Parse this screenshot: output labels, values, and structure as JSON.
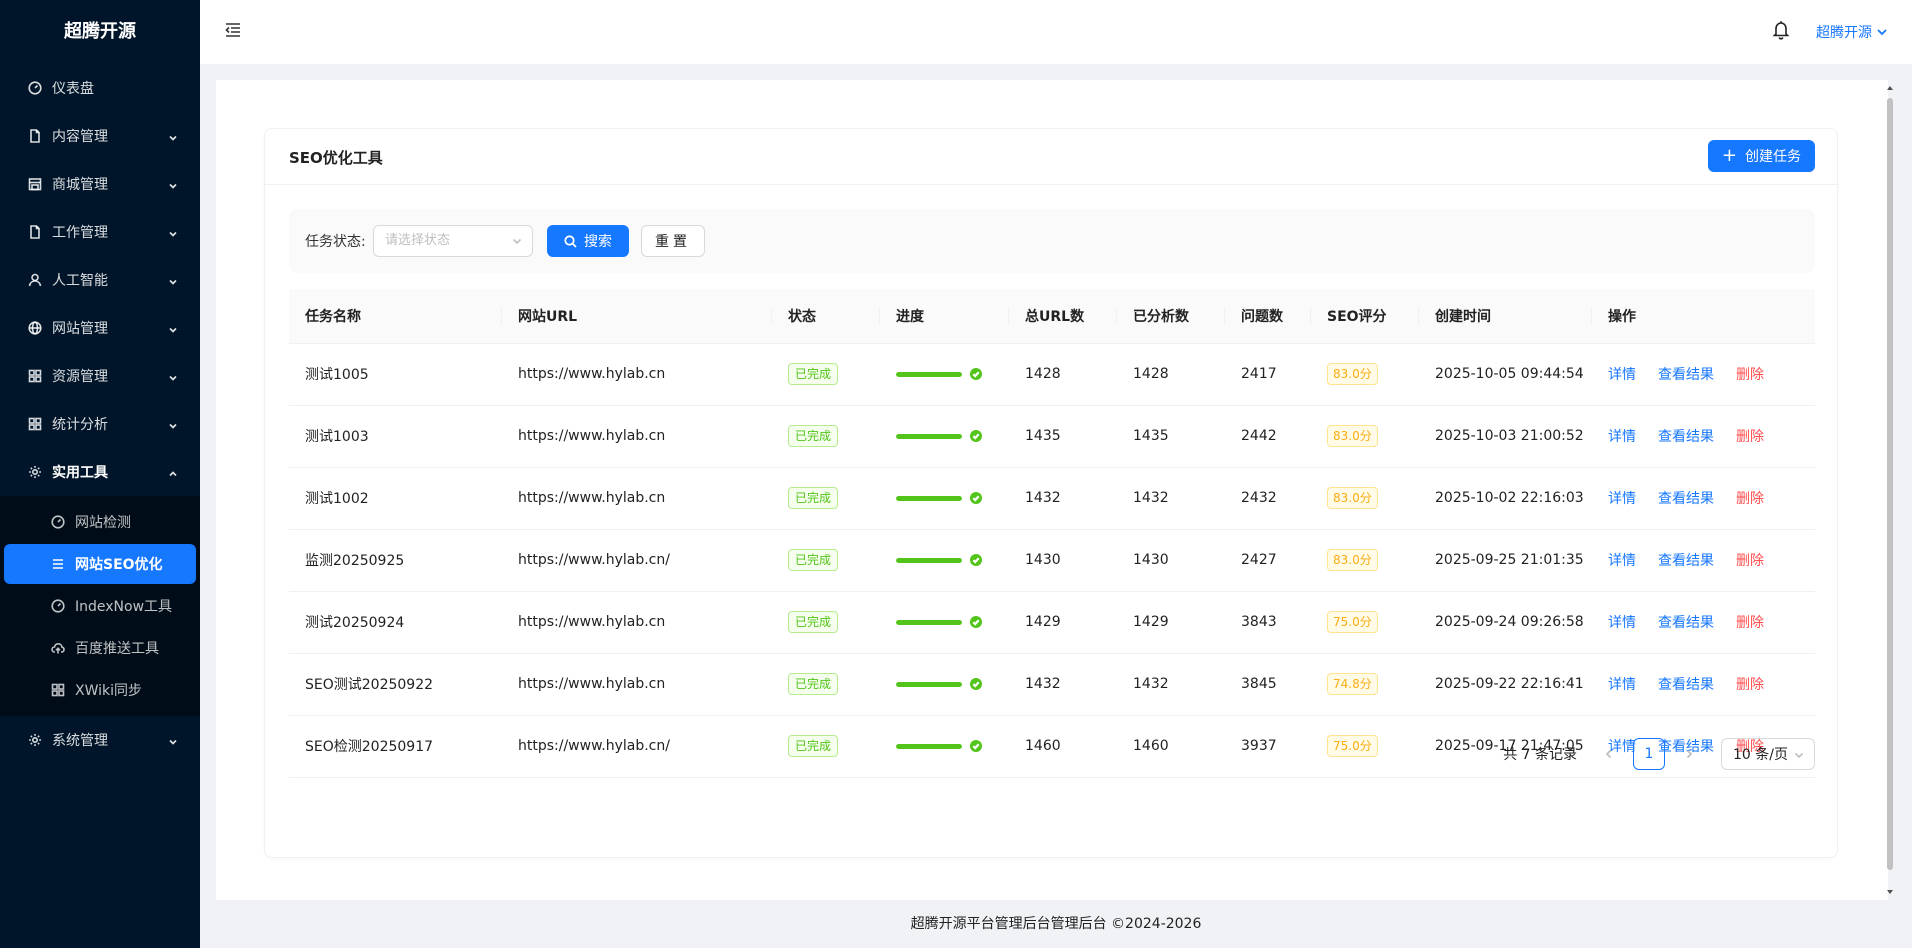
{
  "app": {
    "brand": "超腾开源"
  },
  "sidebar": {
    "items": [
      {
        "label": "仪表盘",
        "icon": "dashboard-icon"
      },
      {
        "label": "内容管理",
        "icon": "file-icon"
      },
      {
        "label": "商城管理",
        "icon": "shop-icon"
      },
      {
        "label": "工作管理",
        "icon": "file-icon"
      },
      {
        "label": "人工智能",
        "icon": "user-icon"
      },
      {
        "label": "网站管理",
        "icon": "globe-icon"
      },
      {
        "label": "资源管理",
        "icon": "grid-icon"
      },
      {
        "label": "统计分析",
        "icon": "grid-icon"
      },
      {
        "label": "实用工具",
        "icon": "gear-icon"
      },
      {
        "label": "系统管理",
        "icon": "gear-icon"
      }
    ],
    "subitems": [
      {
        "label": "网站检测",
        "icon": "dashboard-icon"
      },
      {
        "label": "网站SEO优化",
        "icon": "list-icon"
      },
      {
        "label": "IndexNow工具",
        "icon": "dashboard-icon"
      },
      {
        "label": "百度推送工具",
        "icon": "cloud-upload-icon"
      },
      {
        "label": "XWiki同步",
        "icon": "grid-icon"
      }
    ]
  },
  "header": {
    "user": "超腾开源"
  },
  "card": {
    "title": "SEO优化工具",
    "create_label": "创建任务"
  },
  "filter": {
    "status_label": "任务状态:",
    "status_placeholder": "请选择状态",
    "search_label": "搜索",
    "reset_label": "重置"
  },
  "table": {
    "columns": [
      "任务名称",
      "网站URL",
      "状态",
      "进度",
      "总URL数",
      "已分析数",
      "问题数",
      "SEO评分",
      "创建时间",
      "操作"
    ],
    "actions": {
      "detail": "详情",
      "view": "查看结果",
      "delete": "删除"
    },
    "rows": [
      {
        "name": "测试1005",
        "url": "https://www.hylab.cn",
        "status": "已完成",
        "progress": 100,
        "total": "1428",
        "analyzed": "1428",
        "issues": "2417",
        "score": "83.0分",
        "created": "2025-10-05 09:44:54"
      },
      {
        "name": "测试1003",
        "url": "https://www.hylab.cn",
        "status": "已完成",
        "progress": 100,
        "total": "1435",
        "analyzed": "1435",
        "issues": "2442",
        "score": "83.0分",
        "created": "2025-10-03 21:00:52"
      },
      {
        "name": "测试1002",
        "url": "https://www.hylab.cn",
        "status": "已完成",
        "progress": 100,
        "total": "1432",
        "analyzed": "1432",
        "issues": "2432",
        "score": "83.0分",
        "created": "2025-10-02 22:16:03"
      },
      {
        "name": "监测20250925",
        "url": "https://www.hylab.cn/",
        "status": "已完成",
        "progress": 100,
        "total": "1430",
        "analyzed": "1430",
        "issues": "2427",
        "score": "83.0分",
        "created": "2025-09-25 21:01:35"
      },
      {
        "name": "测试20250924",
        "url": "https://www.hylab.cn",
        "status": "已完成",
        "progress": 100,
        "total": "1429",
        "analyzed": "1429",
        "issues": "3843",
        "score": "75.0分",
        "created": "2025-09-24 09:26:58"
      },
      {
        "name": "SEO测试20250922",
        "url": "https://www.hylab.cn",
        "status": "已完成",
        "progress": 100,
        "total": "1432",
        "analyzed": "1432",
        "issues": "3845",
        "score": "74.8分",
        "created": "2025-09-22 22:16:41"
      },
      {
        "name": "SEO检测20250917",
        "url": "https://www.hylab.cn/",
        "status": "已完成",
        "progress": 100,
        "total": "1460",
        "analyzed": "1460",
        "issues": "3937",
        "score": "75.0分",
        "created": "2025-09-17 21:47:05"
      }
    ]
  },
  "pagination": {
    "total_text": "共 7 条记录",
    "current_page": "1",
    "page_size": "10 条/页"
  },
  "footer": {
    "text": "超腾开源平台管理后台管理后台 ©2024-2026"
  },
  "colors": {
    "primary": "#1677ff",
    "sidebar_bg": "#001529",
    "success": "#52c41a",
    "warning": "#faad14",
    "danger": "#ff4d4f"
  }
}
